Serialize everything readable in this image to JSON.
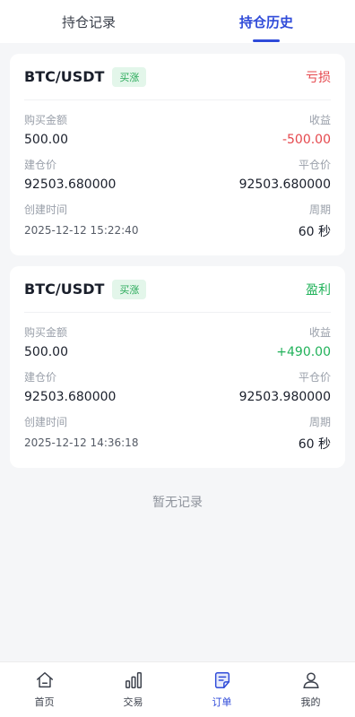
{
  "tabs": [
    {
      "label": "持仓记录",
      "active": false
    },
    {
      "label": "持仓历史",
      "active": true
    }
  ],
  "orders": [
    {
      "pair": "BTC/USDT",
      "direction": "买涨",
      "result": "亏损",
      "amount_label": "购买金额",
      "amount": "500.00",
      "pnl_label": "收益",
      "pnl": "-500.00",
      "open_label": "建仓价",
      "open_price": "92503.680000",
      "close_label": "平仓价",
      "close_price": "92503.680000",
      "time_label": "创建时间",
      "created": "2025-12-12 15:22:40",
      "period_label": "周期",
      "period": "60 秒"
    },
    {
      "pair": "BTC/USDT",
      "direction": "买涨",
      "result": "盈利",
      "amount_label": "购买金额",
      "amount": "500.00",
      "pnl_label": "收益",
      "pnl": "+490.00",
      "open_label": "建仓价",
      "open_price": "92503.680000",
      "close_label": "平仓价",
      "close_price": "92503.980000",
      "time_label": "创建时间",
      "created": "2025-12-12 14:36:18",
      "period_label": "周期",
      "period": "60 秒"
    }
  ],
  "empty_text": "暂无记录",
  "nav": [
    {
      "label": "首页",
      "icon": "home-icon"
    },
    {
      "label": "交易",
      "icon": "chart-bars-icon"
    },
    {
      "label": "订单",
      "icon": "order-icon",
      "active": true
    },
    {
      "label": "我的",
      "icon": "user-icon"
    }
  ],
  "colors": {
    "accent": "#2f4bd9",
    "loss": "#e5484d",
    "profit": "#21b25a",
    "badge_bg": "#e3f6ea"
  }
}
